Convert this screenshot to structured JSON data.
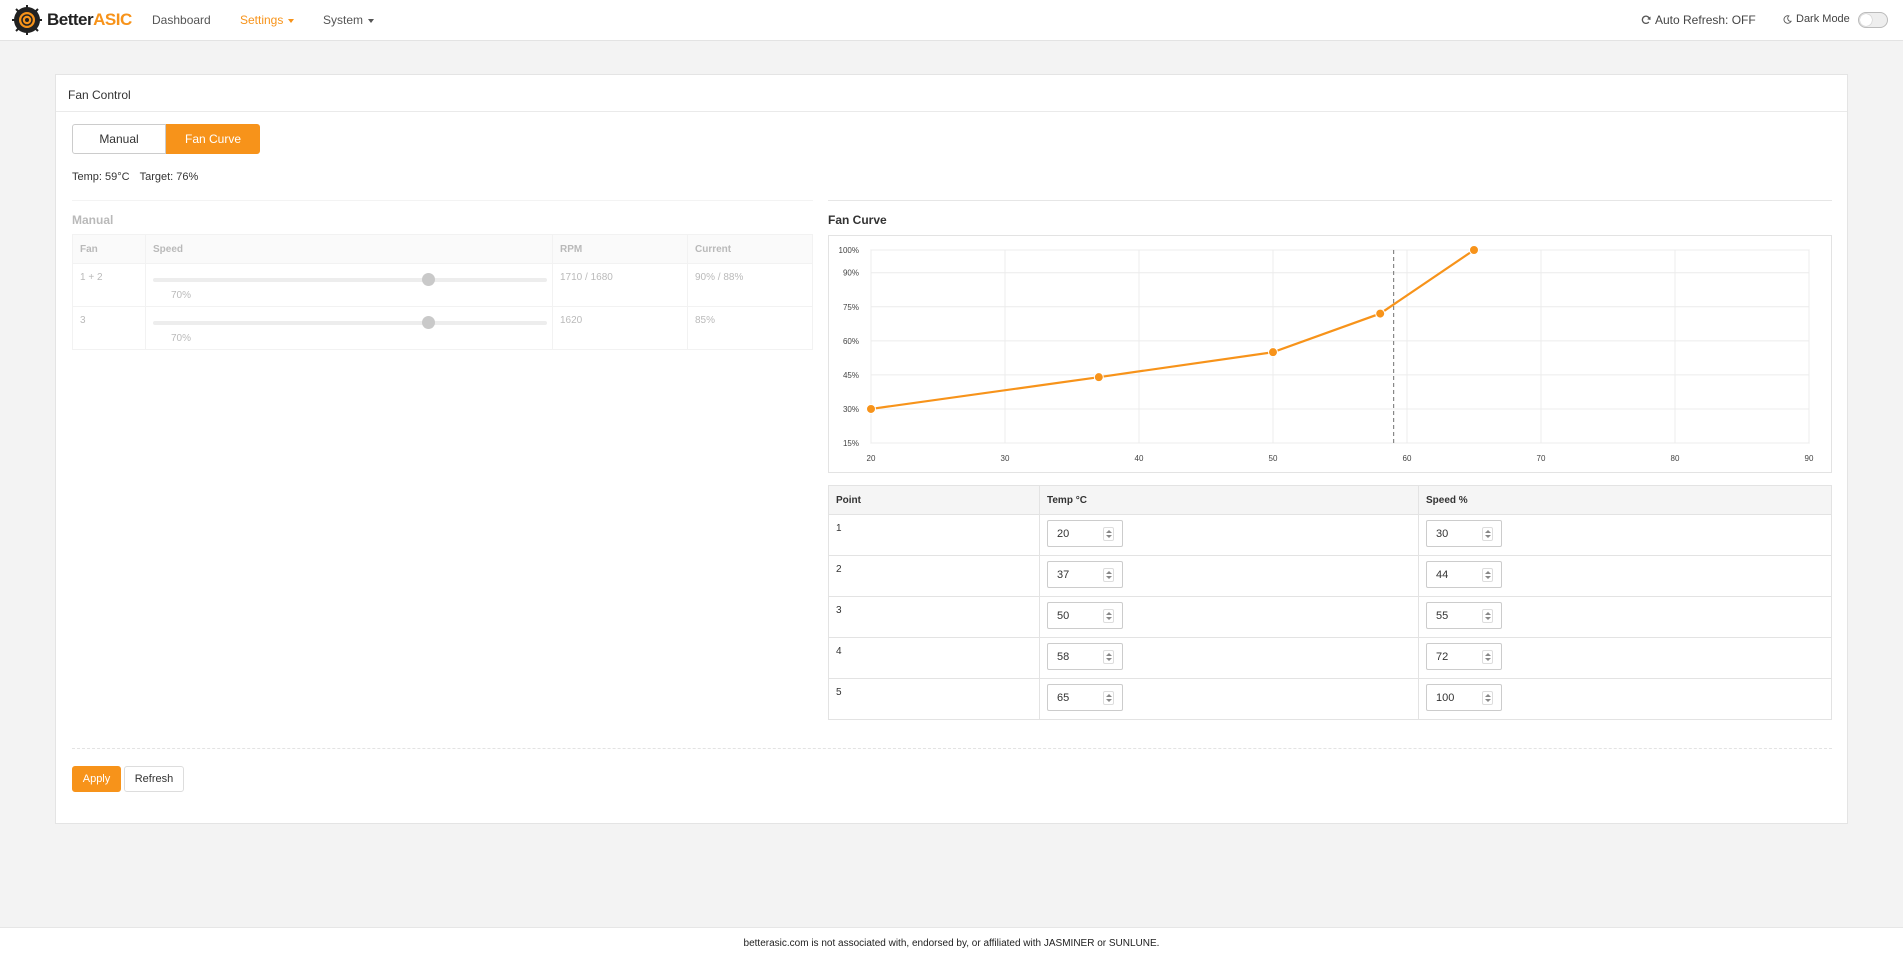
{
  "brand": {
    "part1": "Better",
    "part2": "ASIC",
    "accent": "#f7931a"
  },
  "nav": {
    "dashboard": "Dashboard",
    "settings": "Settings",
    "system": "System",
    "auto_refresh": "Auto Refresh: OFF",
    "dark_mode": "Dark Mode"
  },
  "panel": {
    "title": "Fan Control",
    "mode_manual": "Manual",
    "mode_curve": "Fan Curve",
    "temp": "Temp: 59°C",
    "target": "Target: 76%"
  },
  "manual": {
    "title": "Manual",
    "headers": [
      "Fan",
      "Speed",
      "RPM",
      "Current"
    ],
    "rows": [
      {
        "fan": "1 + 2",
        "speed": 70,
        "speed_label": "70%",
        "rpm": "1710 / 1680",
        "current": "90% / 88%"
      },
      {
        "fan": "3",
        "speed": 70,
        "speed_label": "70%",
        "rpm": "1620",
        "current": "85%"
      }
    ]
  },
  "curve": {
    "title": "Fan Curve",
    "headers": [
      "Point",
      "Temp °C",
      "Speed %"
    ],
    "points": [
      {
        "point": "1",
        "temp": "20",
        "speed": "30"
      },
      {
        "point": "2",
        "temp": "37",
        "speed": "44"
      },
      {
        "point": "3",
        "temp": "50",
        "speed": "55"
      },
      {
        "point": "4",
        "temp": "58",
        "speed": "72"
      },
      {
        "point": "5",
        "temp": "65",
        "speed": "100"
      }
    ]
  },
  "chart_data": {
    "type": "line",
    "x": [
      20,
      37,
      50,
      58,
      65
    ],
    "y": [
      30,
      44,
      55,
      72,
      100
    ],
    "xlim": [
      20,
      90
    ],
    "ylim": [
      15,
      100
    ],
    "x_ticks": [
      "20",
      "30",
      "40",
      "50",
      "60",
      "70",
      "80",
      "90"
    ],
    "y_ticks": [
      "15%",
      "30%",
      "45%",
      "60%",
      "75%",
      "90%",
      "100%"
    ],
    "x_tick_values": [
      20,
      30,
      40,
      50,
      60,
      70,
      80,
      90
    ],
    "y_tick_values": [
      15,
      30,
      45,
      60,
      75,
      90,
      100
    ],
    "current_temp": 59,
    "grid": true,
    "color": "#f7931a"
  },
  "actions": {
    "apply": "Apply",
    "refresh": "Refresh"
  },
  "footer": "betterasic.com is not associated with, endorsed by, or affiliated with JASMINER or SUNLUNE."
}
